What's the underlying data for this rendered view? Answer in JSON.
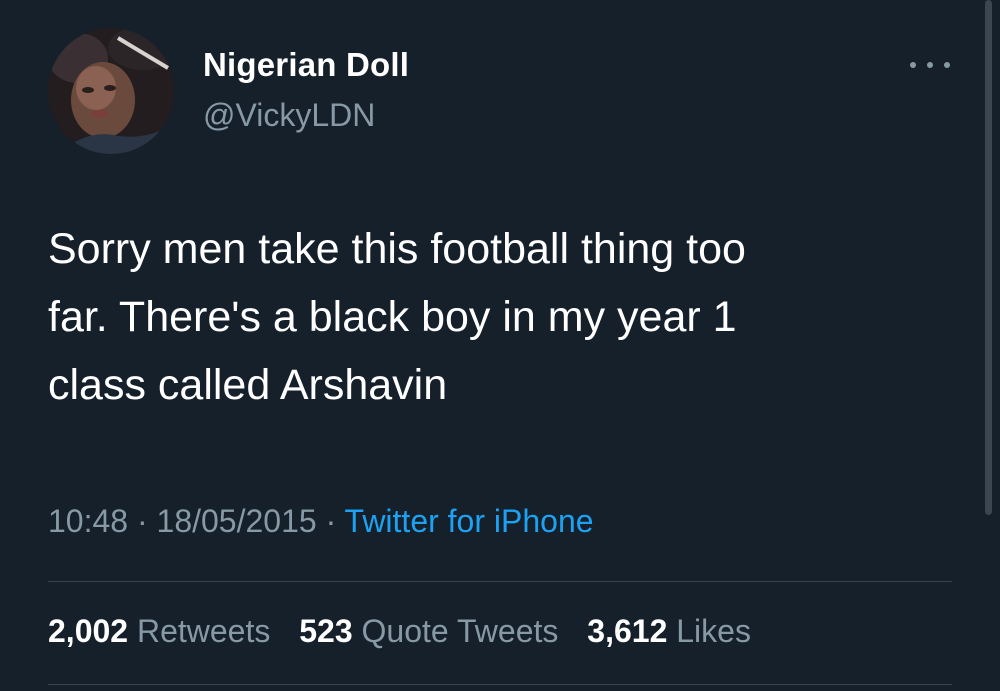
{
  "user": {
    "display_name": "Nigerian Doll",
    "handle": "@VickyLDN"
  },
  "menu": {
    "icon": "more-horizontal-icon"
  },
  "tweet": {
    "text": "Sorry men take this football thing too\nfar. There's a black boy in my year 1\nclass called Arshavin",
    "time": "10:48",
    "date": "18/05/2015",
    "separator": " · ",
    "source": "Twitter for iPhone"
  },
  "stats": {
    "retweets": {
      "count": "2,002",
      "label": "Retweets"
    },
    "quotes": {
      "count": "523",
      "label": "Quote Tweets"
    },
    "likes": {
      "count": "3,612",
      "label": "Likes"
    }
  },
  "colors": {
    "background": "#15202b",
    "primary_text": "#ffffff",
    "secondary_text": "#8899a6",
    "link": "#1da1f2",
    "divider": "#38444d"
  }
}
